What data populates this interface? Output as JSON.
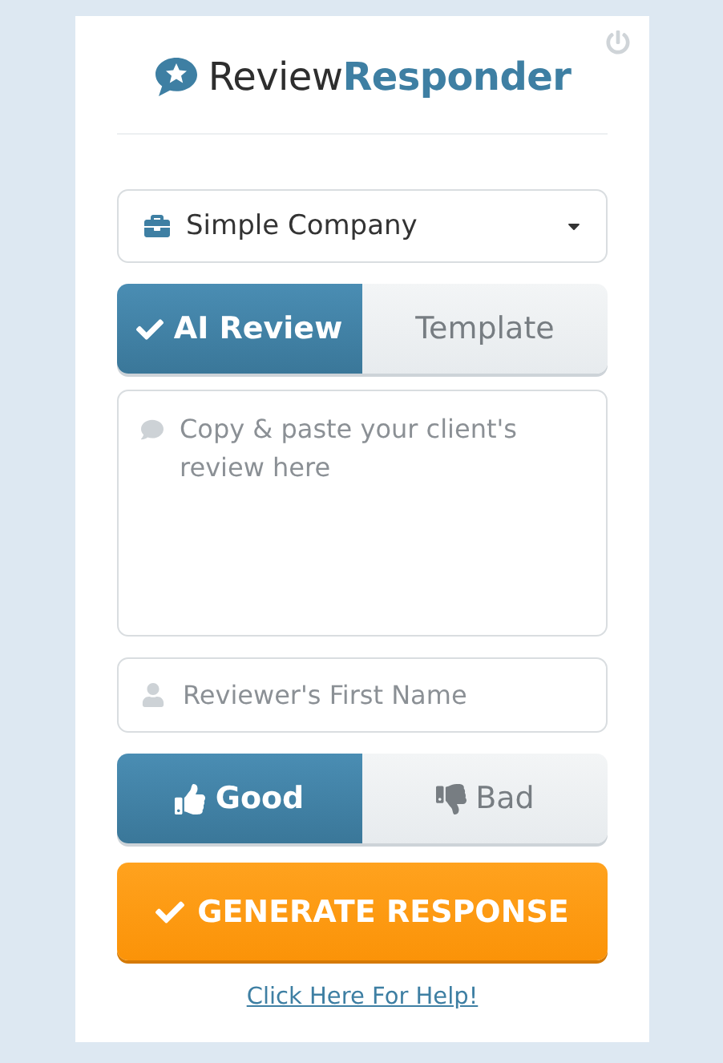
{
  "logo": {
    "first": "Review",
    "second": "Responder"
  },
  "company_select": {
    "value": "Simple Company"
  },
  "mode_tabs": [
    {
      "label": "AI Review",
      "selected": true
    },
    {
      "label": "Template",
      "selected": false
    }
  ],
  "review_field": {
    "placeholder": "Copy & paste your client's review here"
  },
  "name_field": {
    "placeholder": "Reviewer's First Name"
  },
  "sentiment_tabs": [
    {
      "kind": "good",
      "label": "Good",
      "selected": true
    },
    {
      "kind": "bad",
      "label": "Bad",
      "selected": false
    }
  ],
  "generate_button": {
    "label": "GENERATE RESPONSE"
  },
  "help_link": {
    "label": "Click Here For Help!"
  }
}
